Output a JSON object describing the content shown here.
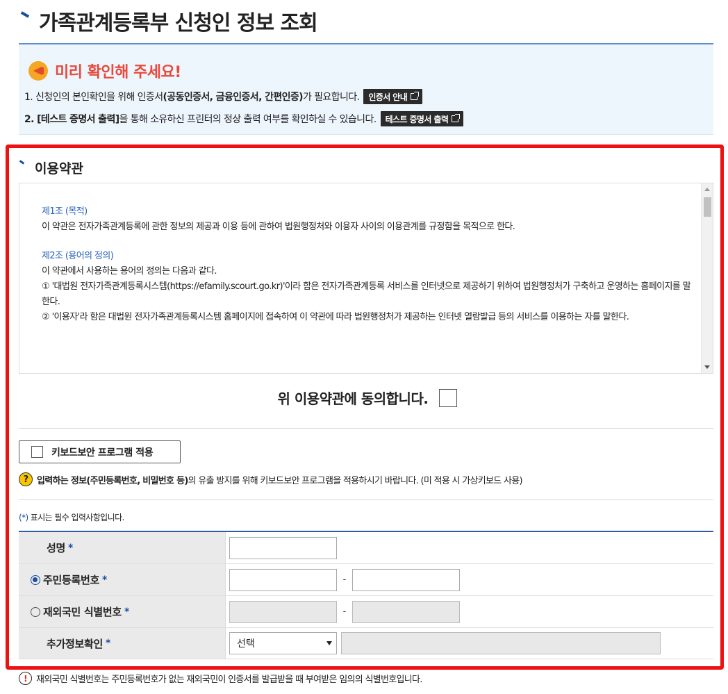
{
  "page_title": "가족관계등록부 신청인 정보 조회",
  "notice": {
    "title": "미리 확인해 주세요!",
    "line1_prefix": "1. 신청인의 본인확인을 위해 인증서",
    "line1_bold": "(공동인증서, 금융인증서, 간편인증)",
    "line1_suffix": "가 필요합니다.",
    "cert_guide_button": "인증서 안내",
    "line2_bold": "2. [테스트 증명서 출력]",
    "line2_suffix": "을 통해 소유하신 프린터의 정상 출력 여부를 확인하실 수 있습니다.",
    "test_print_button": "테스트 증명서 출력"
  },
  "terms": {
    "section_title": "이용약관",
    "art1_title": "제1조 (목적)",
    "art1_body": "이 약관은 전자가족관계등록에 관한 정보의 제공과 이용 등에 관하여 법원행정처와 이용자 사이의 이용관계를 규정함을 목적으로 한다.",
    "art2_title": "제2조 (용어의 정의)",
    "art2_intro": "이 약관에서 사용하는 용어의 정의는 다음과 같다.",
    "art2_item1": "① '대법원 전자가족관계등록시스템(https://efamily.scourt.go.kr)'이라 함은 전자가족관계등록 서비스를 인터넷으로 제공하기 위하여 법원행정처가 구축하고 운영하는 홈페이지를 말한다.",
    "art2_item2": "② '이용자'라 함은 대법원 전자가족관계등록시스템 홈페이지에 접속하여 이 약관에 따라 법원행정처가 제공하는 인터넷 열람발급 등의 서비스를 이용하는 자를 말한다.",
    "agree_label": "위 이용약관에 동의합니다."
  },
  "keyboard_security": {
    "button_label": "키보드보안 프로그램 적용",
    "help_prefix": "입력하는 정보",
    "help_bold": "(주민등록번호, 비밀번호 등)",
    "help_suffix": "의 유출 방지를 위해 키보드보안 프로그램을 적용하시기 바랍니다. (미 적용 시 가상키보드 사용)"
  },
  "form": {
    "required_note_star": "(*)",
    "required_note_text": " 표시는 필수 입력사항입니다.",
    "name_label": "성명",
    "rrn_label": "주민등록번호",
    "overseas_label": "재외국민 식별번호",
    "extra_label": "추가정보확인",
    "star": "*",
    "dash": "-",
    "select_value": "선택",
    "name_value": "",
    "rrn_front": "",
    "rrn_back": ""
  },
  "warning": "재외국민 식별번호는 주민등록번호가 없는 재외국민이 인증서를 발급받을 때 부여받은 임의의 식별번호입니다.",
  "colors": {
    "accent": "#1a4fa0",
    "highlight_frame": "#ee1111",
    "notice_title": "#e8493b"
  }
}
